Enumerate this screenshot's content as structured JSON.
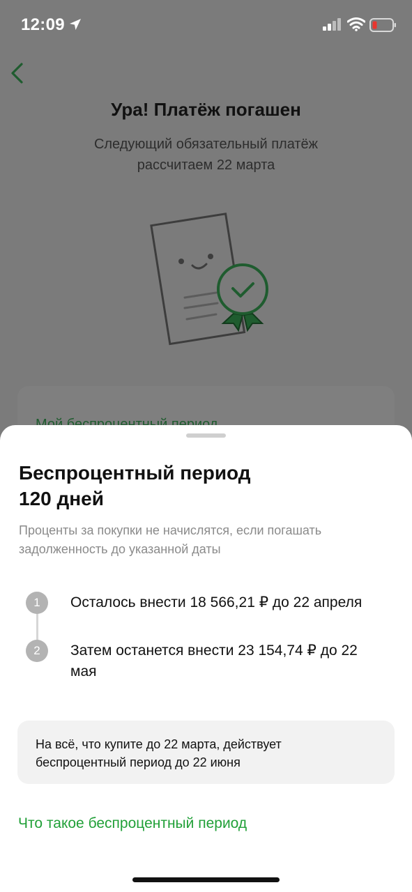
{
  "status_bar": {
    "time": "12:09"
  },
  "background": {
    "title": "Ура! Платёж погашен",
    "subtitle": "Следующий обязательный платёж рассчитаем 22 марта",
    "card_label": "Мой беспроцентный период"
  },
  "sheet": {
    "title_line1": "Беспроцентный период",
    "title_line2": "120 дней",
    "description": "Проценты за покупки не начислятся, если погашать задолженность до указанной даты",
    "steps": [
      {
        "number": "1",
        "text": "Осталось внести 18 566,21 ₽ до 22 апреля"
      },
      {
        "number": "2",
        "text": "Затем останется внести 23 154,74 ₽ до 22 мая"
      }
    ],
    "note": "На всё, что купите до 22 марта, действует беспроцентный период до 22 июня",
    "link": "Что такое беспроцентный период"
  },
  "colors": {
    "accent_green": "#21a038",
    "battery_low": "#e8352e"
  }
}
